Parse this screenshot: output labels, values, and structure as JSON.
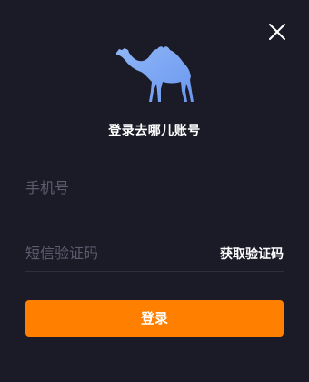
{
  "dialog": {
    "title": "登录去哪儿账号",
    "close_icon": "close-icon",
    "logo_icon": "camel-logo"
  },
  "phone": {
    "placeholder": "手机号",
    "value": ""
  },
  "code": {
    "placeholder": "短信验证码",
    "value": "",
    "get_code_label": "获取验证码"
  },
  "login": {
    "label": "登录"
  },
  "colors": {
    "background": "#1b1b27",
    "accent": "#ff8000",
    "logo": "#7eaaf5",
    "divider": "#2e2e3c",
    "placeholder": "#5c5c6e"
  }
}
